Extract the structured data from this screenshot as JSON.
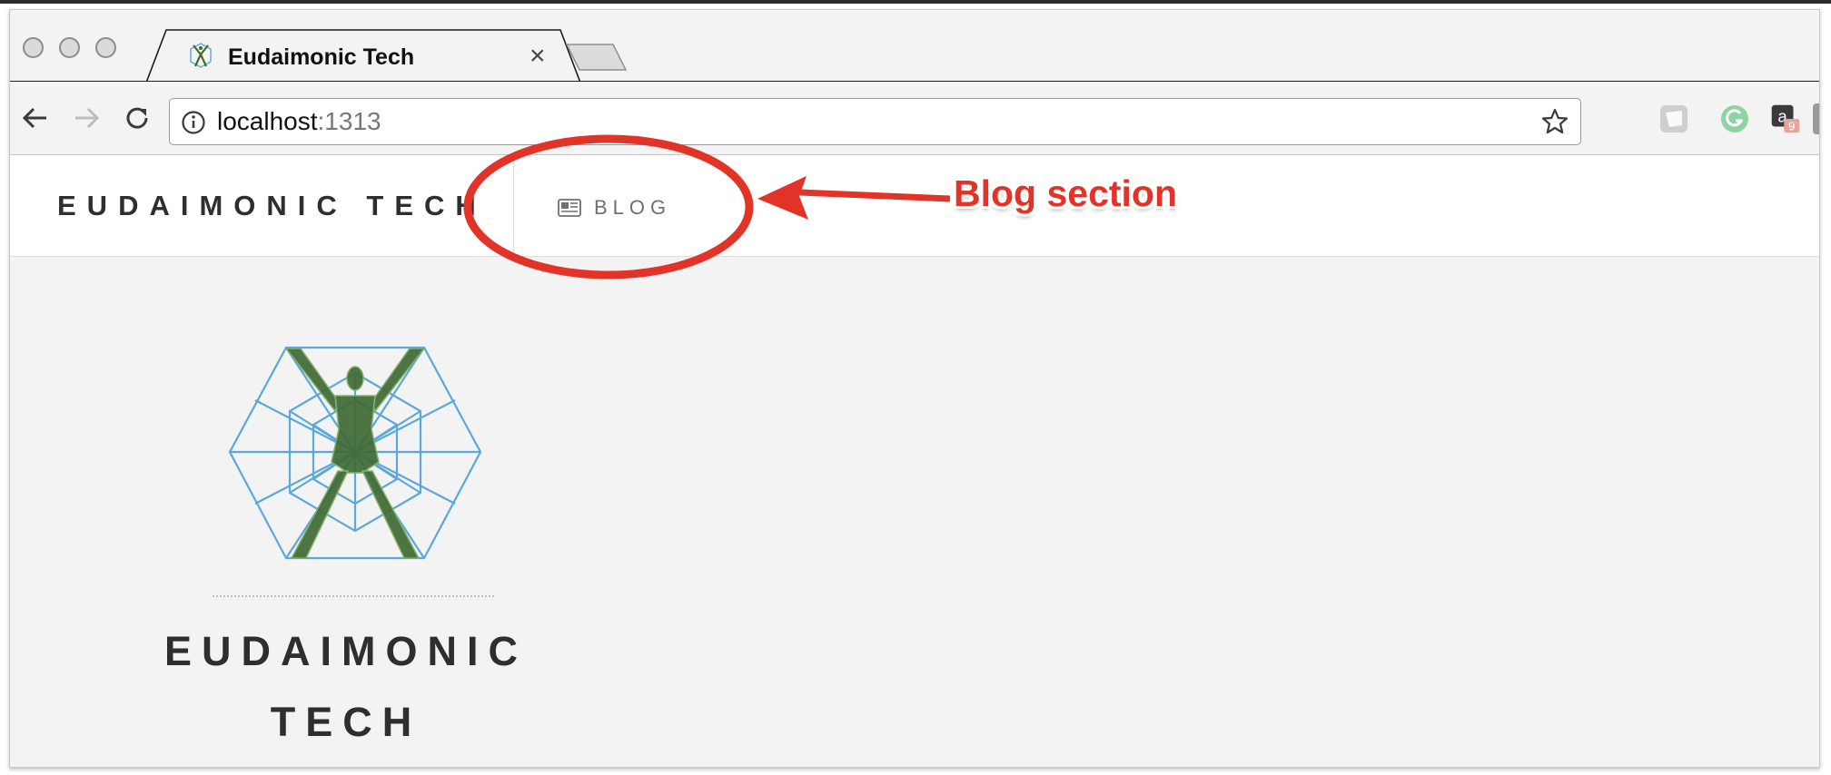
{
  "browser": {
    "tab_title": "Eudaimonic Tech",
    "tab_close_glyph": "×",
    "url_host": "localhost",
    "url_port": ":1313",
    "extension_badge": "9"
  },
  "site": {
    "brand": "EUDAIMONIC TECH",
    "nav": [
      {
        "label": "BLOG",
        "icon": "newspaper-icon"
      }
    ],
    "hero_title_line1": "EUDAIMONIC",
    "hero_title_line2": "TECH"
  },
  "annotation": {
    "label": "Blog section",
    "color": "#e23328"
  },
  "colors": {
    "logo_blue": "#5ba8dc",
    "logo_green": "#3f6b35"
  }
}
